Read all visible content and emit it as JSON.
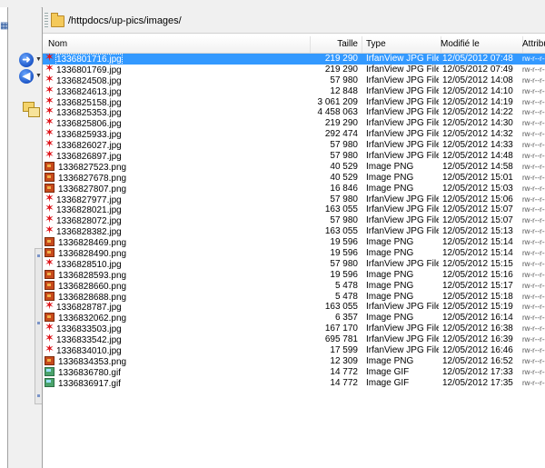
{
  "path": "/httpdocs/up-pics/images/",
  "columns": {
    "name": "Nom",
    "size": "Taille",
    "type": "Type",
    "modified": "Modifié le",
    "attributes": "Attribut"
  },
  "files": [
    {
      "name": "1336801716.jpg",
      "size": "219 290",
      "type": "IrfanView JPG File",
      "modified": "12/05/2012 07:48",
      "attr": "rw-r--r--",
      "icon": "jpg-icon",
      "selected": true
    },
    {
      "name": "1336801769.jpg",
      "size": "219 290",
      "type": "IrfanView JPG File",
      "modified": "12/05/2012 07:49",
      "attr": "rw-r--r--",
      "icon": "jpg-icon"
    },
    {
      "name": "1336824508.jpg",
      "size": "57 980",
      "type": "IrfanView JPG File",
      "modified": "12/05/2012 14:08",
      "attr": "rw-r--r--",
      "icon": "jpg-icon"
    },
    {
      "name": "1336824613.jpg",
      "size": "12 848",
      "type": "IrfanView JPG File",
      "modified": "12/05/2012 14:10",
      "attr": "rw-r--r--",
      "icon": "jpg-icon"
    },
    {
      "name": "1336825158.jpg",
      "size": "3 061 209",
      "type": "IrfanView JPG File",
      "modified": "12/05/2012 14:19",
      "attr": "rw-r--r--",
      "icon": "jpg-icon"
    },
    {
      "name": "1336825353.jpg",
      "size": "4 458 063",
      "type": "IrfanView JPG File",
      "modified": "12/05/2012 14:22",
      "attr": "rw-r--r--",
      "icon": "jpg-icon"
    },
    {
      "name": "1336825806.jpg",
      "size": "219 290",
      "type": "IrfanView JPG File",
      "modified": "12/05/2012 14:30",
      "attr": "rw-r--r--",
      "icon": "jpg-icon"
    },
    {
      "name": "1336825933.jpg",
      "size": "292 474",
      "type": "IrfanView JPG File",
      "modified": "12/05/2012 14:32",
      "attr": "rw-r--r--",
      "icon": "jpg-icon"
    },
    {
      "name": "1336826027.jpg",
      "size": "57 980",
      "type": "IrfanView JPG File",
      "modified": "12/05/2012 14:33",
      "attr": "rw-r--r--",
      "icon": "jpg-icon"
    },
    {
      "name": "1336826897.jpg",
      "size": "57 980",
      "type": "IrfanView JPG File",
      "modified": "12/05/2012 14:48",
      "attr": "rw-r--r--",
      "icon": "jpg-icon"
    },
    {
      "name": "1336827523.png",
      "size": "40 529",
      "type": "Image PNG",
      "modified": "12/05/2012 14:58",
      "attr": "rw-r--r--",
      "icon": "png-icon"
    },
    {
      "name": "1336827678.png",
      "size": "40 529",
      "type": "Image PNG",
      "modified": "12/05/2012 15:01",
      "attr": "rw-r--r--",
      "icon": "png-icon"
    },
    {
      "name": "1336827807.png",
      "size": "16 846",
      "type": "Image PNG",
      "modified": "12/05/2012 15:03",
      "attr": "rw-r--r--",
      "icon": "png-icon"
    },
    {
      "name": "1336827977.jpg",
      "size": "57 980",
      "type": "IrfanView JPG File",
      "modified": "12/05/2012 15:06",
      "attr": "rw-r--r--",
      "icon": "jpg-icon"
    },
    {
      "name": "1336828021.jpg",
      "size": "163 055",
      "type": "IrfanView JPG File",
      "modified": "12/05/2012 15:07",
      "attr": "rw-r--r--",
      "icon": "jpg-icon"
    },
    {
      "name": "1336828072.jpg",
      "size": "57 980",
      "type": "IrfanView JPG File",
      "modified": "12/05/2012 15:07",
      "attr": "rw-r--r--",
      "icon": "jpg-icon"
    },
    {
      "name": "1336828382.jpg",
      "size": "163 055",
      "type": "IrfanView JPG File",
      "modified": "12/05/2012 15:13",
      "attr": "rw-r--r--",
      "icon": "jpg-icon"
    },
    {
      "name": "1336828469.png",
      "size": "19 596",
      "type": "Image PNG",
      "modified": "12/05/2012 15:14",
      "attr": "rw-r--r--",
      "icon": "png-icon"
    },
    {
      "name": "1336828490.png",
      "size": "19 596",
      "type": "Image PNG",
      "modified": "12/05/2012 15:14",
      "attr": "rw-r--r--",
      "icon": "png-icon"
    },
    {
      "name": "1336828510.jpg",
      "size": "57 980",
      "type": "IrfanView JPG File",
      "modified": "12/05/2012 15:15",
      "attr": "rw-r--r--",
      "icon": "jpg-icon"
    },
    {
      "name": "1336828593.png",
      "size": "19 596",
      "type": "Image PNG",
      "modified": "12/05/2012 15:16",
      "attr": "rw-r--r--",
      "icon": "png-icon"
    },
    {
      "name": "1336828660.png",
      "size": "5 478",
      "type": "Image PNG",
      "modified": "12/05/2012 15:17",
      "attr": "rw-r--r--",
      "icon": "png-icon"
    },
    {
      "name": "1336828688.png",
      "size": "5 478",
      "type": "Image PNG",
      "modified": "12/05/2012 15:18",
      "attr": "rw-r--r--",
      "icon": "png-icon"
    },
    {
      "name": "1336828787.jpg",
      "size": "163 055",
      "type": "IrfanView JPG File",
      "modified": "12/05/2012 15:19",
      "attr": "rw-r--r--",
      "icon": "jpg-icon"
    },
    {
      "name": "1336832062.png",
      "size": "6 357",
      "type": "Image PNG",
      "modified": "12/05/2012 16:14",
      "attr": "rw-r--r--",
      "icon": "png-icon"
    },
    {
      "name": "1336833503.jpg",
      "size": "167 170",
      "type": "IrfanView JPG File",
      "modified": "12/05/2012 16:38",
      "attr": "rw-r--r--",
      "icon": "jpg-icon"
    },
    {
      "name": "1336833542.jpg",
      "size": "695 781",
      "type": "IrfanView JPG File",
      "modified": "12/05/2012 16:39",
      "attr": "rw-r--r--",
      "icon": "jpg-icon"
    },
    {
      "name": "1336834010.jpg",
      "size": "17 599",
      "type": "IrfanView JPG File",
      "modified": "12/05/2012 16:46",
      "attr": "rw-r--r--",
      "icon": "jpg-icon"
    },
    {
      "name": "1336834353.png",
      "size": "12 309",
      "type": "Image PNG",
      "modified": "12/05/2012 16:52",
      "attr": "rw-r--r--",
      "icon": "png-icon"
    },
    {
      "name": "1336836780.gif",
      "size": "14 772",
      "type": "Image GIF",
      "modified": "12/05/2012 17:33",
      "attr": "rw-r--r--",
      "icon": "gif-icon"
    },
    {
      "name": "1336836917.gif",
      "size": "14 772",
      "type": "Image GIF",
      "modified": "12/05/2012 17:35",
      "attr": "rw-r--r--",
      "icon": "gif-icon"
    }
  ],
  "colors": {
    "selection": "#3399ff",
    "jpg_icon": "#e0141a",
    "png_icon": "#c74a1c",
    "gif_icon": "#4aa36b"
  }
}
